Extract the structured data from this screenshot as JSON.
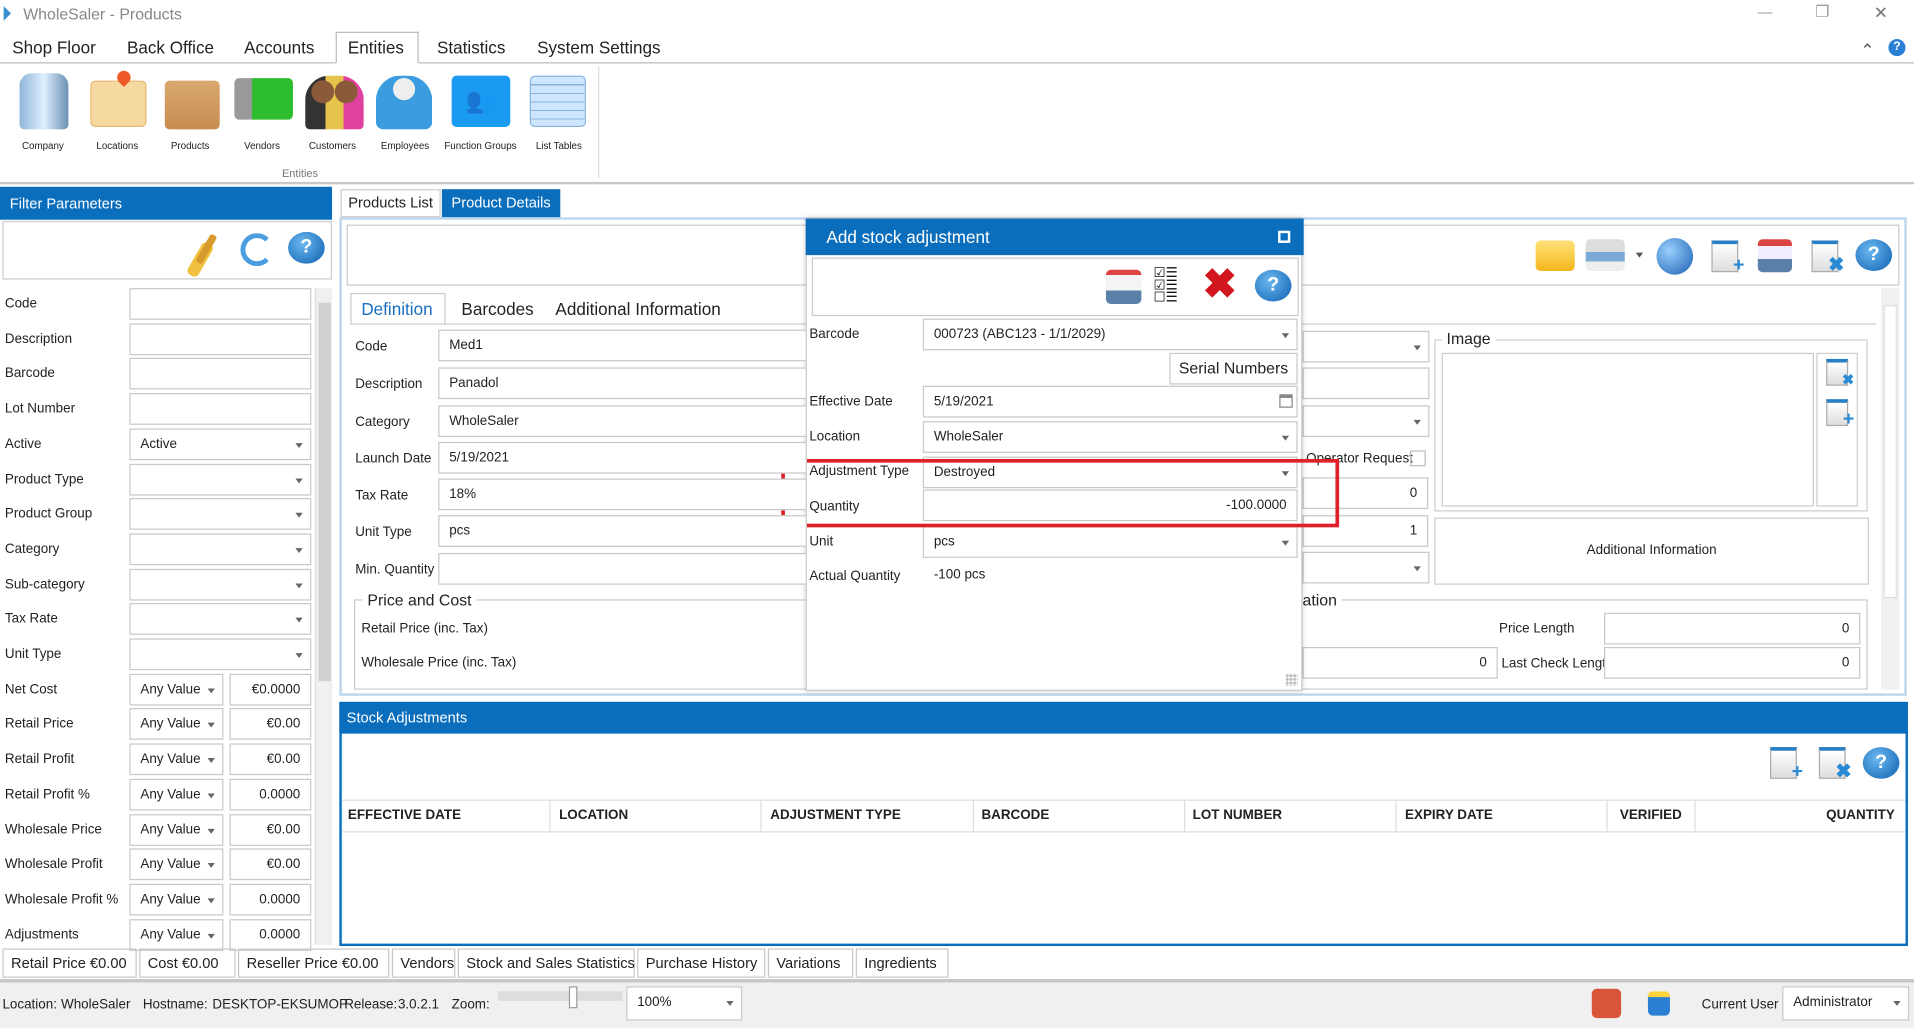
{
  "window": {
    "title": "WholeSaler - Products",
    "minimize": "—",
    "restore": "❐",
    "close": "✕"
  },
  "menu": {
    "tabs": [
      "Shop Floor",
      "Back Office",
      "Accounts",
      "Entities",
      "Statistics",
      "System Settings"
    ],
    "active": "Entities",
    "collapse": "⌃",
    "help": "?"
  },
  "ribbon": {
    "items": [
      "Company",
      "Locations",
      "Products",
      "Vendors",
      "Customers",
      "Employees",
      "Function Groups",
      "List Tables"
    ],
    "group_label": "Entities"
  },
  "filter": {
    "title": "Filter Parameters",
    "fields": [
      {
        "label": "Code",
        "value": ""
      },
      {
        "label": "Description",
        "value": ""
      },
      {
        "label": "Barcode",
        "value": ""
      },
      {
        "label": "Lot Number",
        "value": ""
      },
      {
        "label": "Active",
        "value": "Active",
        "type": "select"
      },
      {
        "label": "Product Type",
        "value": "",
        "type": "select"
      },
      {
        "label": "Product Group",
        "value": "",
        "type": "select"
      },
      {
        "label": "Category",
        "value": "",
        "type": "select"
      },
      {
        "label": "Sub-category",
        "value": "",
        "type": "select"
      },
      {
        "label": "Tax Rate",
        "value": "",
        "type": "select"
      },
      {
        "label": "Unit Type",
        "value": "",
        "type": "select"
      }
    ],
    "ranges": [
      {
        "label": "Net Cost",
        "op": "Any Value",
        "value": "€0.0000"
      },
      {
        "label": "Retail Price",
        "op": "Any Value",
        "value": "€0.00"
      },
      {
        "label": "Retail Profit",
        "op": "Any Value",
        "value": "€0.00"
      },
      {
        "label": "Retail Profit %",
        "op": "Any Value",
        "value": "0.0000"
      },
      {
        "label": "Wholesale Price",
        "op": "Any Value",
        "value": "€0.00"
      },
      {
        "label": "Wholesale Profit",
        "op": "Any Value",
        "value": "€0.00"
      },
      {
        "label": "Wholesale Profit %",
        "op": "Any Value",
        "value": "0.0000"
      },
      {
        "label": "Adjustments",
        "op": "Any Value",
        "value": "0.0000"
      }
    ]
  },
  "main_tabs": [
    "Products List",
    "Product Details"
  ],
  "details": {
    "tabs": [
      "Definition",
      "Barcodes",
      "Additional Information"
    ],
    "fields": [
      {
        "label": "Code",
        "value": "Med1"
      },
      {
        "label": "Description",
        "value": "Panadol"
      },
      {
        "label": "Category",
        "value": "WholeSaler"
      },
      {
        "label": "Launch Date",
        "value": "5/19/2021"
      },
      {
        "label": "Tax Rate",
        "value": "18%"
      },
      {
        "label": "Unit Type",
        "value": "pcs"
      },
      {
        "label": "Min. Quantity",
        "value": ""
      }
    ],
    "price_group": "Price and Cost",
    "retail_price_label": "Retail Price (inc. Tax)",
    "wholesale_price_label": "Wholesale Price (inc. Tax)",
    "operator_request": "Operator Request",
    "field_zero": "0",
    "field_one": "1",
    "info_group_partial": "ation",
    "image_group": "Image",
    "additional_info_button": "Additional Information",
    "price_length_label": "Price Length",
    "price_length": "0",
    "last_check_label": "Last Check Length",
    "last_check": "0",
    "other_zero": "0"
  },
  "dialog": {
    "title": "Add stock adjustment",
    "barcode_label": "Barcode",
    "barcode": "000723 (ABC123 - 1/1/2029)",
    "serial_button": "Serial Numbers",
    "date_label": "Effective Date",
    "date": "5/19/2021",
    "location_label": "Location",
    "location": "WholeSaler",
    "type_label": "Adjustment Type",
    "type": "Destroyed",
    "qty_label": "Quantity",
    "qty": "-100.0000",
    "unit_label": "Unit",
    "unit": "pcs",
    "actual_label": "Actual Quantity",
    "actual": "-100 pcs",
    "highlight_color": "#e0202a"
  },
  "stock": {
    "title": "Stock Adjustments",
    "columns": [
      "EFFECTIVE DATE",
      "LOCATION",
      "ADJUSTMENT TYPE",
      "BARCODE",
      "LOT NUMBER",
      "EXPIRY DATE",
      "VERIFIED",
      "QUANTITY"
    ],
    "rows": []
  },
  "bottom_tabs": [
    "Retail Price  €0.00",
    "Cost  €0.00",
    "Reseller Price  €0.00",
    "Vendors",
    "Stock and Sales Statistics",
    "Purchase History",
    "Variations",
    "Ingredients"
  ],
  "status": {
    "location_label": "Location:",
    "location": "WholeSaler",
    "host_label": "Hostname:",
    "host": "DESKTOP-EKSUMOP",
    "release_label": "Release:",
    "release": "3.0.2.1",
    "zoom_label": "Zoom:",
    "zoom": "100%",
    "zoom_level": 0.5,
    "user_label": "Current User",
    "user": "Administrator"
  },
  "colors": {
    "accent": "#0a6ebd"
  }
}
